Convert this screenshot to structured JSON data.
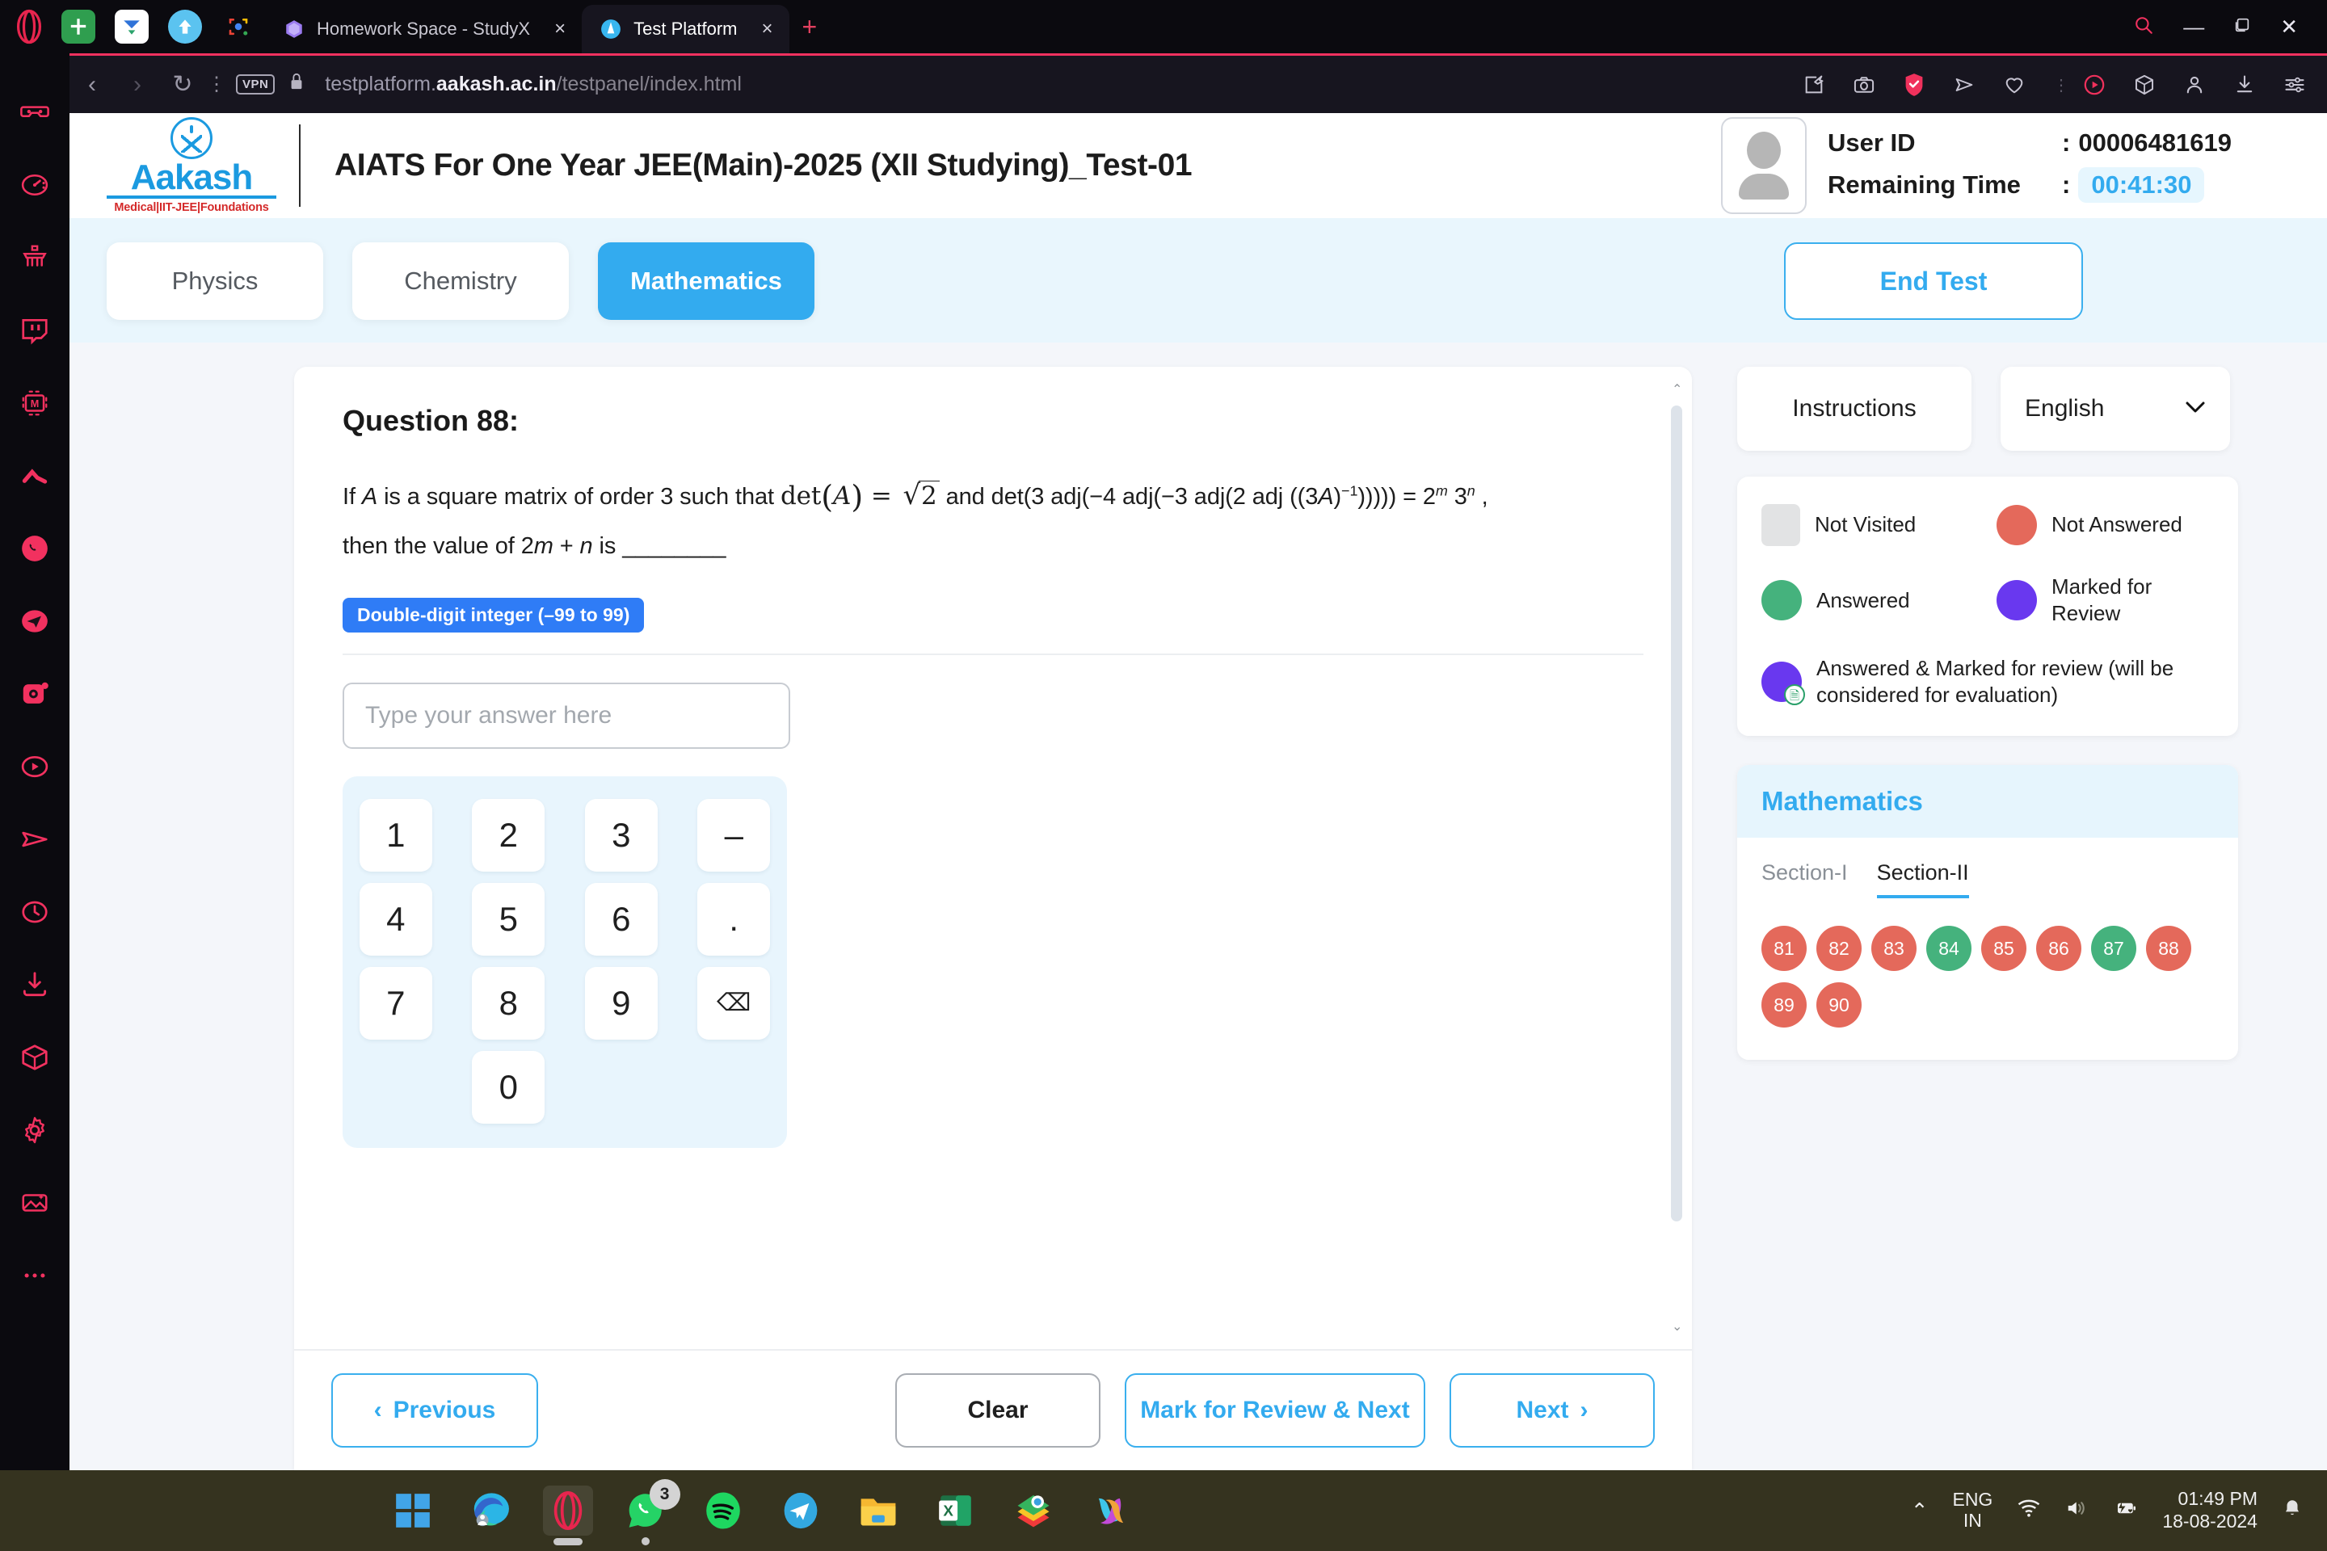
{
  "browser": {
    "quick_icons": [
      "plus-green-icon",
      "mail-icon",
      "upload-arrow-icon",
      "lens-icon"
    ],
    "tabs": [
      {
        "title": "Homework Space - StudyX",
        "favicon": "studyx-icon",
        "active": false,
        "close_label": "×"
      },
      {
        "title": "Test Platform",
        "favicon": "aakash-icon",
        "active": true,
        "close_label": "×"
      }
    ],
    "new_tab_label": "+",
    "window_controls": {
      "search": "⌕",
      "minimize": "—",
      "maximize": "❐",
      "close": "✕"
    },
    "nav": {
      "back": "‹",
      "forward": "›",
      "reload": "↻",
      "menu_dots": "⋮"
    },
    "vpn_label": "VPN",
    "lock_icon": "lock-icon",
    "url": {
      "prefix": "testplatform.",
      "domain": "aakash.ac.in",
      "path": "/testpanel/index.html"
    },
    "toolbar_icons": [
      "pin-page-icon",
      "snapshot-icon",
      "shield-check-icon",
      "send-icon",
      "heart-icon",
      "divider",
      "player-icon",
      "cube-icon",
      "person-icon",
      "download-icon",
      "easy-setup-icon"
    ],
    "left_rail_icons": [
      "vr-goggles-icon",
      "speed-dial-icon",
      "cleaner-icon",
      "twitch-icon",
      "messenger-m-icon",
      "aria-icon",
      "whatsapp-icon",
      "telegram-icon",
      "instagram-icon",
      "player-circle-icon",
      "send-plane-icon",
      "history-clock-icon",
      "downloads-icon",
      "cube-box-icon",
      "settings-gear-icon",
      "image-sparkle-icon",
      "more-dots-icon"
    ]
  },
  "header": {
    "logo_word": "Aakash",
    "logo_tagline": "Medical|IIT-JEE|Foundations",
    "test_title": "AIATS For One Year JEE(Main)-2025 (XII Studying)_Test-01",
    "user_id_label": "User ID",
    "user_id_sep": ":",
    "user_id_value": "00006481619",
    "remaining_label": "Remaining Time",
    "remaining_sep": ":",
    "remaining_value": "00:41:30"
  },
  "subject_bar": {
    "tabs": [
      {
        "label": "Physics",
        "active": false
      },
      {
        "label": "Chemistry",
        "active": false
      },
      {
        "label": "Mathematics",
        "active": true
      }
    ],
    "end_test_label": "End Test"
  },
  "question": {
    "title": "Question 88:",
    "text_part_1": "If ",
    "var_A": "A",
    "text_part_2": " is a square matrix of order 3 such that ",
    "math_det": "det",
    "math_open": "(",
    "math_var": "A",
    "math_close": ")",
    "math_eq": "=",
    "math_radical": "√",
    "math_radicand": "2",
    "text_part_3": " and det(3 adj(−4 adj(−3 adj(2 adj ((3",
    "text_part_3b": "A",
    "text_part_3c": ")",
    "sup_inv": "−1",
    "text_part_3d": "))))) = 2",
    "sup_m": "m",
    "text_part_3e": " 3",
    "sup_n": "n",
    "text_part_3f": " ,",
    "text_part_4": "then the value of 2",
    "var_m": "m",
    "text_plus": " + ",
    "var_n": "n",
    "text_part_5": " is ________",
    "type_badge": "Double-digit integer (–99 to 99)",
    "answer_placeholder": "Type your answer here",
    "answer_value": ""
  },
  "keypad": {
    "keys": [
      "1",
      "2",
      "3",
      "–",
      "4",
      "5",
      "6",
      ".",
      "7",
      "8",
      "9",
      "⌫",
      "0"
    ],
    "backspace_name": "backspace-key"
  },
  "footer": {
    "previous_label": "Previous",
    "previous_icon": "‹",
    "clear_label": "Clear",
    "mark_review_label": "Mark for Review & Next",
    "next_label": "Next",
    "next_icon": "›"
  },
  "sidebar": {
    "instructions_label": "Instructions",
    "language_value": "English",
    "language_chevron": "⌄",
    "legend": [
      {
        "label": "Not Visited",
        "style": "square-gray",
        "color": "#e2e3e4"
      },
      {
        "label": "Not Answered",
        "style": "circle-red",
        "color": "#e4695b"
      },
      {
        "label": "Answered",
        "style": "circle-green",
        "color": "#45b27d"
      },
      {
        "label": "Marked for Review",
        "style": "circle-purple",
        "color": "#6938ef"
      },
      {
        "label": "Answered & Marked for review (will be considered for evaluation)",
        "style": "circle-combo",
        "color": "#6938ef"
      }
    ],
    "palette_subject": "Mathematics",
    "section_tabs": [
      {
        "label": "Section-I",
        "active": false
      },
      {
        "label": "Section-II",
        "active": true
      }
    ],
    "questions": [
      {
        "num": "81",
        "state": "red"
      },
      {
        "num": "82",
        "state": "red"
      },
      {
        "num": "83",
        "state": "red"
      },
      {
        "num": "84",
        "state": "green"
      },
      {
        "num": "85",
        "state": "red"
      },
      {
        "num": "86",
        "state": "red"
      },
      {
        "num": "87",
        "state": "green"
      },
      {
        "num": "88",
        "state": "red"
      },
      {
        "num": "89",
        "state": "red"
      },
      {
        "num": "90",
        "state": "red"
      }
    ]
  },
  "taskbar": {
    "apps": [
      {
        "name": "start-button",
        "icon": "windows-logo-icon"
      },
      {
        "name": "edge-app",
        "icon": "edge-icon"
      },
      {
        "name": "opera-app",
        "icon": "opera-icon",
        "running": true,
        "active": true
      },
      {
        "name": "whatsapp-app",
        "icon": "whatsapp-icon",
        "badge": "3",
        "running": true
      },
      {
        "name": "spotify-app",
        "icon": "spotify-icon"
      },
      {
        "name": "telegram-app",
        "icon": "telegram-icon"
      },
      {
        "name": "file-explorer-app",
        "icon": "folder-icon"
      },
      {
        "name": "excel-app",
        "icon": "excel-icon"
      },
      {
        "name": "photos-app",
        "icon": "photos-icon"
      },
      {
        "name": "copilot-app",
        "icon": "copilot-icon"
      }
    ],
    "tray": {
      "chevron": "⌃",
      "lang_line1": "ENG",
      "lang_line2": "IN",
      "wifi_icon": "wifi-icon",
      "volume_icon": "volume-icon",
      "battery_icon": "battery-icon",
      "time": "01:49 PM",
      "date": "18-08-2024",
      "bell_icon": "notification-bell-icon"
    }
  }
}
